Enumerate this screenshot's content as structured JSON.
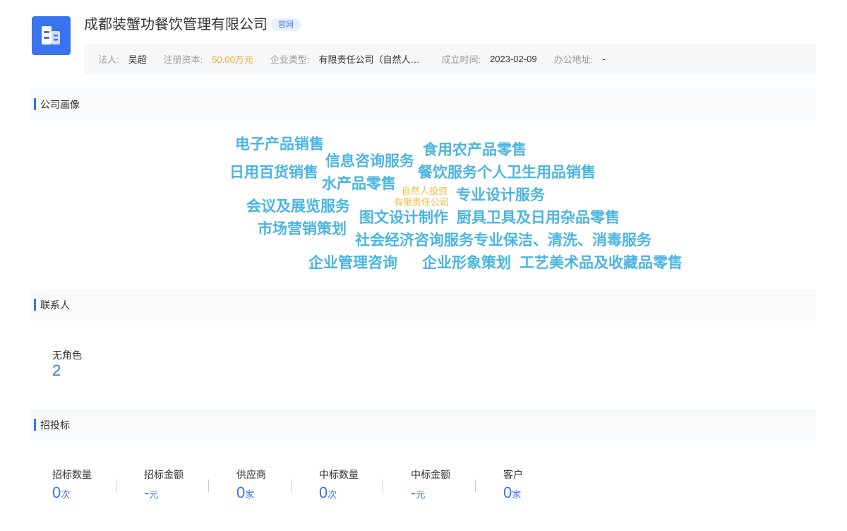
{
  "header": {
    "company_name": "成都装蟹功餐饮管理有限公司",
    "official_tag": "官网",
    "logo_icon": "building-icon"
  },
  "info": {
    "legal_label": "法人:",
    "legal_value": "吴超",
    "capital_label": "注册资本:",
    "capital_value": "50.00万元",
    "type_label": "企业类型:",
    "type_value": "有限责任公司（自然人投资或控股）",
    "founded_label": "成立时间:",
    "founded_value": "2023-02-09",
    "address_label": "办公地址:",
    "address_value": "-"
  },
  "portrait": {
    "title": "公司画像",
    "words": [
      "电子产品销售",
      "信息咨询服务",
      "食用农产品零售",
      "日用百货销售",
      "餐饮服务个人卫生用品销售",
      "水产品零售",
      "自然人投资",
      "有限责任公司",
      "专业设计服务",
      "会议及展览服务",
      "图文设计制作",
      "厨具卫具及日用杂品零售",
      "市场营销策划",
      "社会经济咨询服务专业保洁、清洗、消毒服务",
      "企业管理咨询",
      "企业形象策划",
      "工艺美术品及收藏品零售"
    ],
    "colors": {
      "primary": "#4bb5e2",
      "secondary": "#f5b942"
    }
  },
  "contacts": {
    "title": "联系人",
    "role_label": "无角色",
    "role_value": "2"
  },
  "bidding": {
    "title": "招投标",
    "stats": [
      {
        "label": "招标数量",
        "value": "0",
        "unit": "次"
      },
      {
        "label": "招标金额",
        "value": "-",
        "unit": "元"
      },
      {
        "label": "供应商",
        "value": "0",
        "unit": "家"
      },
      {
        "label": "中标数量",
        "value": "0",
        "unit": "次"
      },
      {
        "label": "中标金额",
        "value": "-",
        "unit": "元"
      },
      {
        "label": "客户",
        "value": "0",
        "unit": "家"
      }
    ]
  },
  "accent_color": "#3a73f0"
}
